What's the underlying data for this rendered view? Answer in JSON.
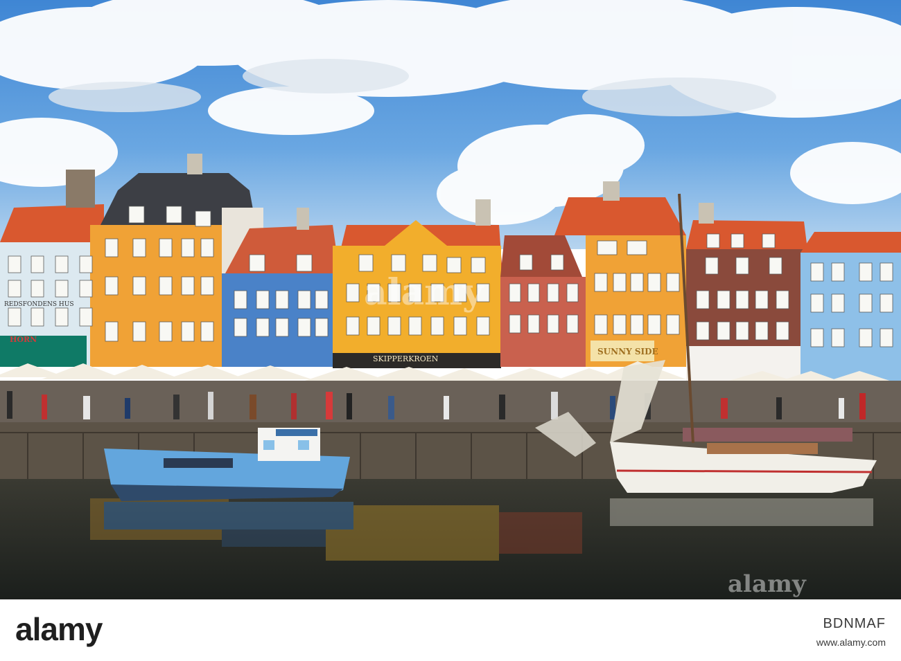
{
  "photo": {
    "signs": {
      "sign_left": "REDSFONDENS HUS",
      "sign_horn": "HORN",
      "sign_skipperkroen": "SKIPPERKROEN",
      "sign_sunny": "SUNNY SIDE"
    },
    "watermark": {
      "center_logo": "alamy",
      "corner_logo": "alamy"
    }
  },
  "footer": {
    "brand": "alamy",
    "image_id": "BDNMAF",
    "site": "www.alamy.com"
  },
  "colors": {
    "sky": "#4a8fd8",
    "water": "#262a26",
    "orange_house": "#f0a236",
    "blue_house": "#4a82c8",
    "yellow_house": "#f2ae2c",
    "red_house": "#c9614e",
    "light_blue_house": "#8ec0e8",
    "brick_house": "#8a4a3c",
    "roof_tile": "#d9582f",
    "boat_blue": "#63a6dd",
    "boat_white": "#f1efe8"
  }
}
